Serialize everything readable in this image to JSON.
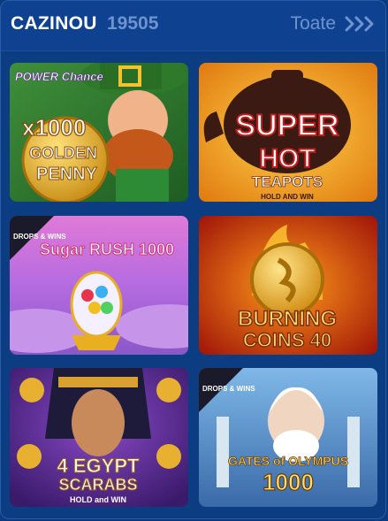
{
  "header": {
    "title": "CAZINOU",
    "count": "19505",
    "view_all": "Toate"
  },
  "tiles": [
    {
      "name": "game-1000-golden-penny",
      "badge": "POWER Chance",
      "line1": "x1000",
      "line2": "GOLDEN",
      "line3": "PENNY"
    },
    {
      "name": "game-super-hot-teapots",
      "line1": "SUPER",
      "line2": "HOT",
      "line3": "TEAPOTS",
      "line4": "HOLD AND WIN"
    },
    {
      "name": "game-sugar-rush-1000",
      "badge": "DROPS & WINS",
      "line1": "Sugar RUSH 1000"
    },
    {
      "name": "game-burning-coins-40",
      "line1": "BURNING",
      "line2": "COINS 40"
    },
    {
      "name": "game-4-egypt-scarabs",
      "line1": "4 EGYPT",
      "line2": "SCARABS",
      "line3": "HOLD and WIN"
    },
    {
      "name": "game-gates-of-olympus-1000",
      "badge": "DROPS & WINS",
      "line1": "GATES of OLYMPUS",
      "line2": "1000"
    }
  ],
  "colors": {
    "background": "#0c3d82",
    "accent": "#6f93cf"
  }
}
